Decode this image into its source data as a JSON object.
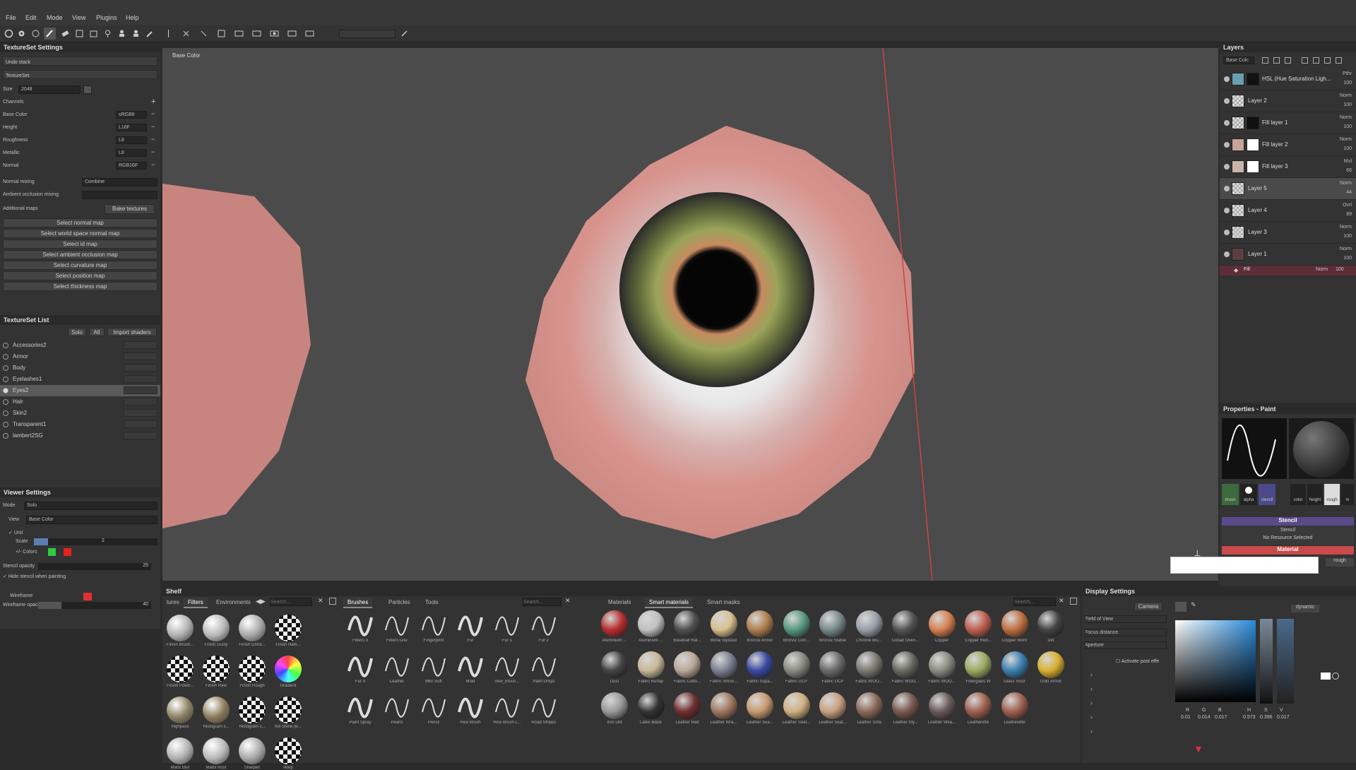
{
  "menu": [
    "File",
    "Edit",
    "Mode",
    "View",
    "Plugins",
    "Help"
  ],
  "textureset_settings": {
    "title": "TextureSet Settings",
    "undo_stack": "Undo stack",
    "textureset": "TextureSet",
    "size_label": "Size",
    "size_value": "2048",
    "channels_label": "Channels",
    "channels": [
      {
        "name": "Base Color",
        "format": "sRGB8"
      },
      {
        "name": "Height",
        "format": "L16F"
      },
      {
        "name": "Roughness",
        "format": "L8"
      },
      {
        "name": "Metallic",
        "format": "L8"
      },
      {
        "name": "Normal",
        "format": "RGB16F"
      }
    ],
    "normal_mixing_label": "Normal mixing",
    "normal_mixing_value": "Combine",
    "ao_mixing_label": "Ambient occlusion mixing",
    "additional_maps_label": "Additional maps",
    "bake_button": "Bake textures",
    "maps": [
      "Select normal map",
      "Select world space normal map",
      "Select id map",
      "Select ambient occlusion map",
      "Select curvature map",
      "Select position map",
      "Select thickness map"
    ]
  },
  "textureset_list": {
    "title": "TextureSet List",
    "solo": "Solo",
    "all": "All",
    "import": "Import shaders",
    "items": [
      "Accessories2",
      "Armor",
      "Body",
      "Eyelashes1",
      "Eyes2",
      "Hair",
      "Skin2",
      "Transparent1",
      "lambert2SG"
    ],
    "selected": "Eyes2"
  },
  "viewer_settings": {
    "title": "Viewer Settings",
    "mode_label": "Mode",
    "mode_value": "Solo",
    "view_label": "View",
    "view_value": "Base Color",
    "unit_label": "Unit",
    "scale_label": "Scale",
    "scale_value": "2",
    "colors_label": "+/- Colors",
    "stencil_opacity_label": "Stencil opacity",
    "stencil_opacity_value": "25",
    "hide_stencil_label": "Hide stencil when painting",
    "wireframe_label": "Wireframe",
    "wireframe_opacity_label": "Wireframe opacity",
    "wireframe_opacity_value": "40"
  },
  "viewport": {
    "channel_label": "Base Color"
  },
  "layers": {
    "title": "Layers",
    "channel_dropdown": "Base Colc",
    "items": [
      {
        "name": "HSL (Hue Saturation Ligh...",
        "mode": "Pthr",
        "opacity": "100"
      },
      {
        "name": "Layer 2",
        "mode": "Norm",
        "opacity": "100"
      },
      {
        "name": "Fill layer 1",
        "mode": "Norm",
        "opacity": "100"
      },
      {
        "name": "Fill layer 2",
        "mode": "Norm",
        "opacity": "100"
      },
      {
        "name": "Fill layer 3",
        "mode": "Mul",
        "opacity": "66"
      },
      {
        "name": "Layer 5",
        "mode": "Norm",
        "opacity": "44"
      },
      {
        "name": "Layer 4",
        "mode": "Ovrl",
        "opacity": "89"
      },
      {
        "name": "Layer 3",
        "mode": "Norm",
        "opacity": "100"
      },
      {
        "name": "Layer 1",
        "mode": "Norm",
        "opacity": "100"
      }
    ],
    "effect": {
      "name": "Fill",
      "mode": "Norm",
      "opacity": "100"
    }
  },
  "properties": {
    "title": "Properties - Paint",
    "slots": [
      "brush",
      "alpha",
      "stencil"
    ],
    "mat_slots": [
      "color",
      "height",
      "rough",
      "m"
    ],
    "stencil_header": "Stencil",
    "stencil_sub": "Stencil",
    "stencil_none": "No Resource Selected",
    "material_header": "Material",
    "rough_label": "rough"
  },
  "shelf": {
    "title": "Shelf",
    "left_tabs": [
      "tures",
      "Filters",
      "Environments"
    ],
    "left_active": "Filters",
    "search_placeholder": "Search...",
    "filters": [
      "Finish Brush...",
      "Finish Dusty",
      "Finish Grind...",
      "Finish Ham...",
      "Finish Powd...",
      "Finish Raw",
      "Finish Rough",
      "Gradient",
      "Highpass",
      "Histogram s...",
      "Histogram s...",
      "Kill Shine (B...",
      "Matfx Blur",
      "Matfx Rust",
      "Sharpen",
      "Warp"
    ],
    "mid_tabs": [
      "Brushes",
      "Particles",
      "Tools"
    ],
    "mid_active": "Brushes",
    "brushes": [
      "Fibers 3",
      "Fibers Line",
      "Fingerprint",
      "Fur",
      "Fur 1",
      "Fur 2",
      "Fur 3",
      "Leather",
      "Mk0 Soft",
      "Mold",
      "new_brush...",
      "Paint Drops",
      "Paint Spray",
      "Pearls",
      "Pencil",
      "Rice Brush",
      "Rice Brush L...",
      "Road Stripes"
    ],
    "right_tabs": [
      "Materials",
      "Smart materials",
      "Smart masks"
    ],
    "right_active": "Smart materials",
    "materials": [
      "Aluminium ...",
      "Aluminium ...",
      "Baseball Hat...",
      "Bone Stylized",
      "Bronze Armor",
      "Bronze Corr...",
      "Bronze Statue",
      "Chrome Blu...",
      "Cobalt Oven...",
      "Copper",
      "Copper Red...",
      "Copper Worn",
      "Dirt",
      "Dust",
      "Fabric Burlap",
      "Fabric Cotto...",
      "Fabric Smoo...",
      "Fabric Supa...",
      "Fabric UCP",
      "Fabric UCP",
      "Fabric WOO...",
      "Fabric WOO...",
      "Fabric WOO...",
      "Fiberglass W",
      "Glass Visor",
      "Gold Armor",
      "Iron Old",
      "Latex Black",
      "Leather Red",
      "Leather Wra...",
      "Leather Sea...",
      "Leather Seat...",
      "Leather Seat...",
      "Leather Sofa",
      "Leather Sty...",
      "Leather Wea...",
      "Leatherette",
      "Leatherette"
    ]
  },
  "display_settings": {
    "title": "Display Settings",
    "camera_button": "Camera",
    "fov_label": "Field of View",
    "focus_label": "Focus distance",
    "aperture_label": "Aperture",
    "post_label": "Activate post effe",
    "dynamic_label": "dynamic",
    "r_label": "R",
    "g_label": "G",
    "b_label": "B",
    "h_label": "H",
    "s_label": "S",
    "v_label": "V",
    "r_value": "0.01",
    "g_value": "0.014",
    "b_value": "0.017",
    "h_value": "0.573",
    "s_value": "0.396",
    "v_value": "0.017"
  },
  "colors": {
    "accent_red": "#c94a4a",
    "stencil_purple": "#5a4a8a",
    "skin": "#d8938d"
  }
}
